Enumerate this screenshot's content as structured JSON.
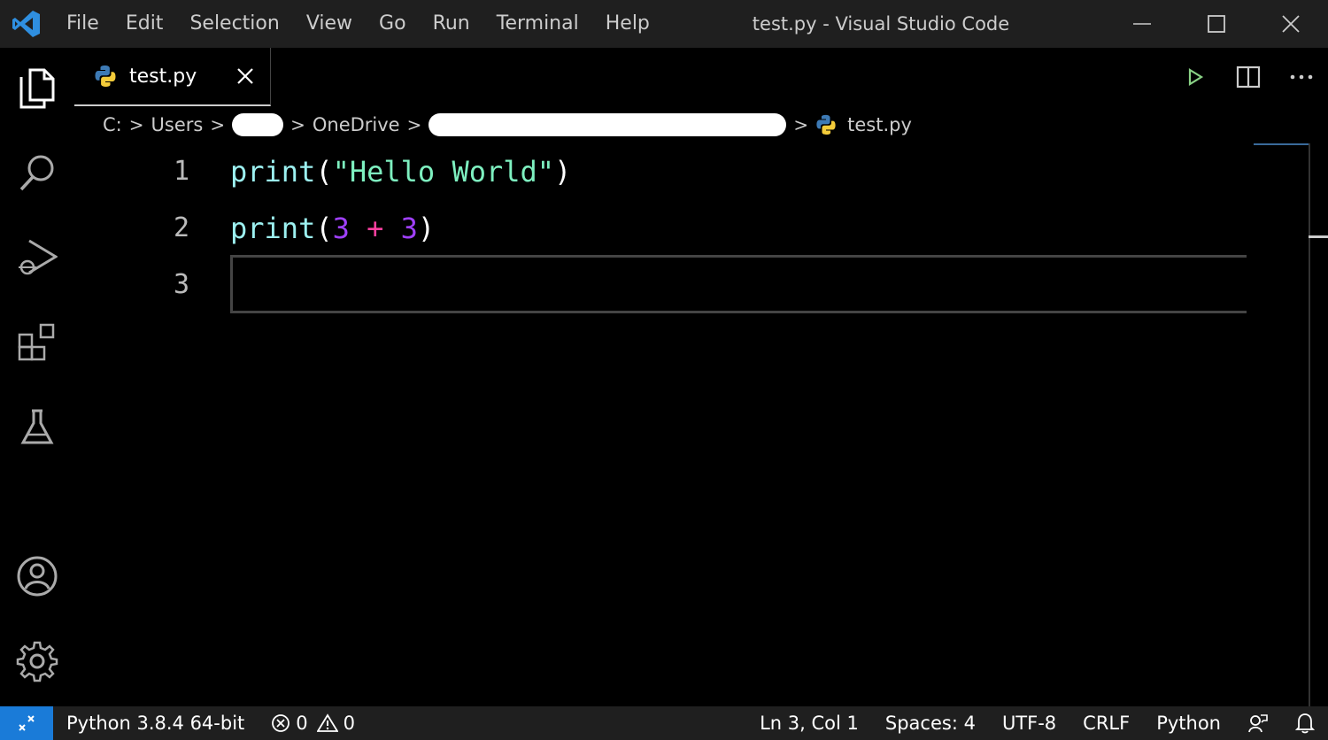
{
  "window": {
    "title": "test.py - Visual Studio Code"
  },
  "menu": {
    "items": [
      "File",
      "Edit",
      "Selection",
      "View",
      "Go",
      "Run",
      "Terminal",
      "Help"
    ]
  },
  "tab": {
    "label": "test.py",
    "icon": "python-icon"
  },
  "breadcrumb": {
    "items": [
      "C:",
      "Users",
      "OneDrive",
      "test.py"
    ]
  },
  "editor": {
    "line_numbers": [
      "1",
      "2",
      "3"
    ],
    "lines": [
      {
        "tokens": [
          {
            "type": "fn",
            "text": "print"
          },
          {
            "type": "paren",
            "text": "("
          },
          {
            "type": "str",
            "text": "\"Hello World\""
          },
          {
            "type": "paren",
            "text": ")"
          }
        ]
      },
      {
        "tokens": [
          {
            "type": "fn",
            "text": "print"
          },
          {
            "type": "paren",
            "text": "("
          },
          {
            "type": "num",
            "text": "3"
          },
          {
            "type": "paren",
            "text": " "
          },
          {
            "type": "op",
            "text": "+"
          },
          {
            "type": "paren",
            "text": " "
          },
          {
            "type": "num",
            "text": "3"
          },
          {
            "type": "paren",
            "text": ")"
          }
        ]
      },
      {
        "tokens": []
      }
    ]
  },
  "statusbar": {
    "interpreter": "Python 3.8.4 64-bit",
    "errors": "0",
    "warnings": "0",
    "cursor": "Ln 3, Col 1",
    "spaces": "Spaces: 4",
    "encoding": "UTF-8",
    "eol": "CRLF",
    "language": "Python"
  },
  "colors": {
    "accent": "#1a7bd8",
    "run": "#89d185"
  }
}
